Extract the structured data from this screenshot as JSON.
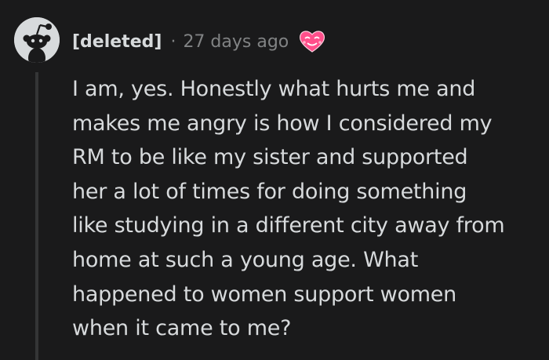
{
  "comment": {
    "author": "[deleted]",
    "separator": "·",
    "timestamp": "27 days ago",
    "avatar_icon": "snoo-avatar-icon",
    "award_icon": "heart-eyes-award-icon",
    "colors": {
      "background": "#1a1a1b",
      "text": "#d7dadc",
      "meta_text": "#818384",
      "thread_line": "#343536",
      "award_pink": "#ff4f8b"
    },
    "body_lines": [
      "I am, yes. Honestly what hurts me and",
      "makes me angry is how I considered my",
      "RM to be like my sister and supported",
      "her a lot of times for doing something",
      "like studying in a different city away from",
      "home at such a young age. What",
      "happened to women support women",
      "when it came to me?"
    ]
  }
}
